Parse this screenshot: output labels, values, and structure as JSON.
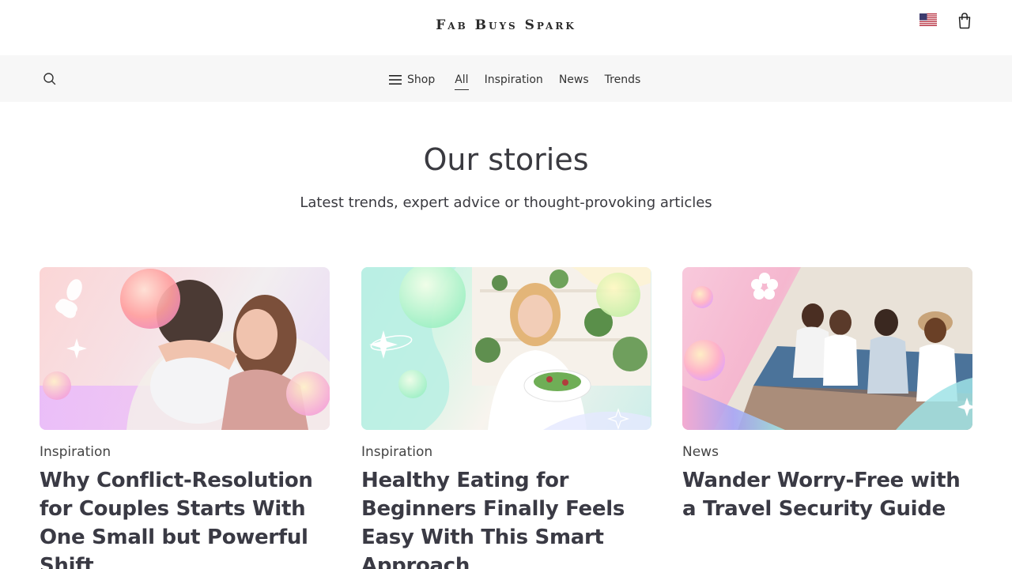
{
  "header": {
    "brand": "Fab Buys Spark",
    "flag_icon": "us-flag-icon",
    "cart_icon": "shopping-bag-icon"
  },
  "nav": {
    "search_icon": "search-icon",
    "shop_label": "Shop",
    "items": [
      {
        "label": "All",
        "active": true
      },
      {
        "label": "Inspiration",
        "active": false
      },
      {
        "label": "News",
        "active": false
      },
      {
        "label": "Trends",
        "active": false
      }
    ]
  },
  "hero": {
    "title": "Our stories",
    "subtitle": "Latest trends, expert advice or thought-provoking articles"
  },
  "articles": [
    {
      "category": "Inspiration",
      "title": "Why Conflict-Resolution for Couples Starts With One Small but Powerful Shift"
    },
    {
      "category": "Inspiration",
      "title": "Healthy Eating for Beginners Finally Feels Easy With This Smart Approach"
    },
    {
      "category": "News",
      "title": "Wander Worry-Free with a Travel Security Guide"
    }
  ],
  "colors": {
    "text": "#3a3a40",
    "navbar_bg": "#f7f7f7"
  }
}
